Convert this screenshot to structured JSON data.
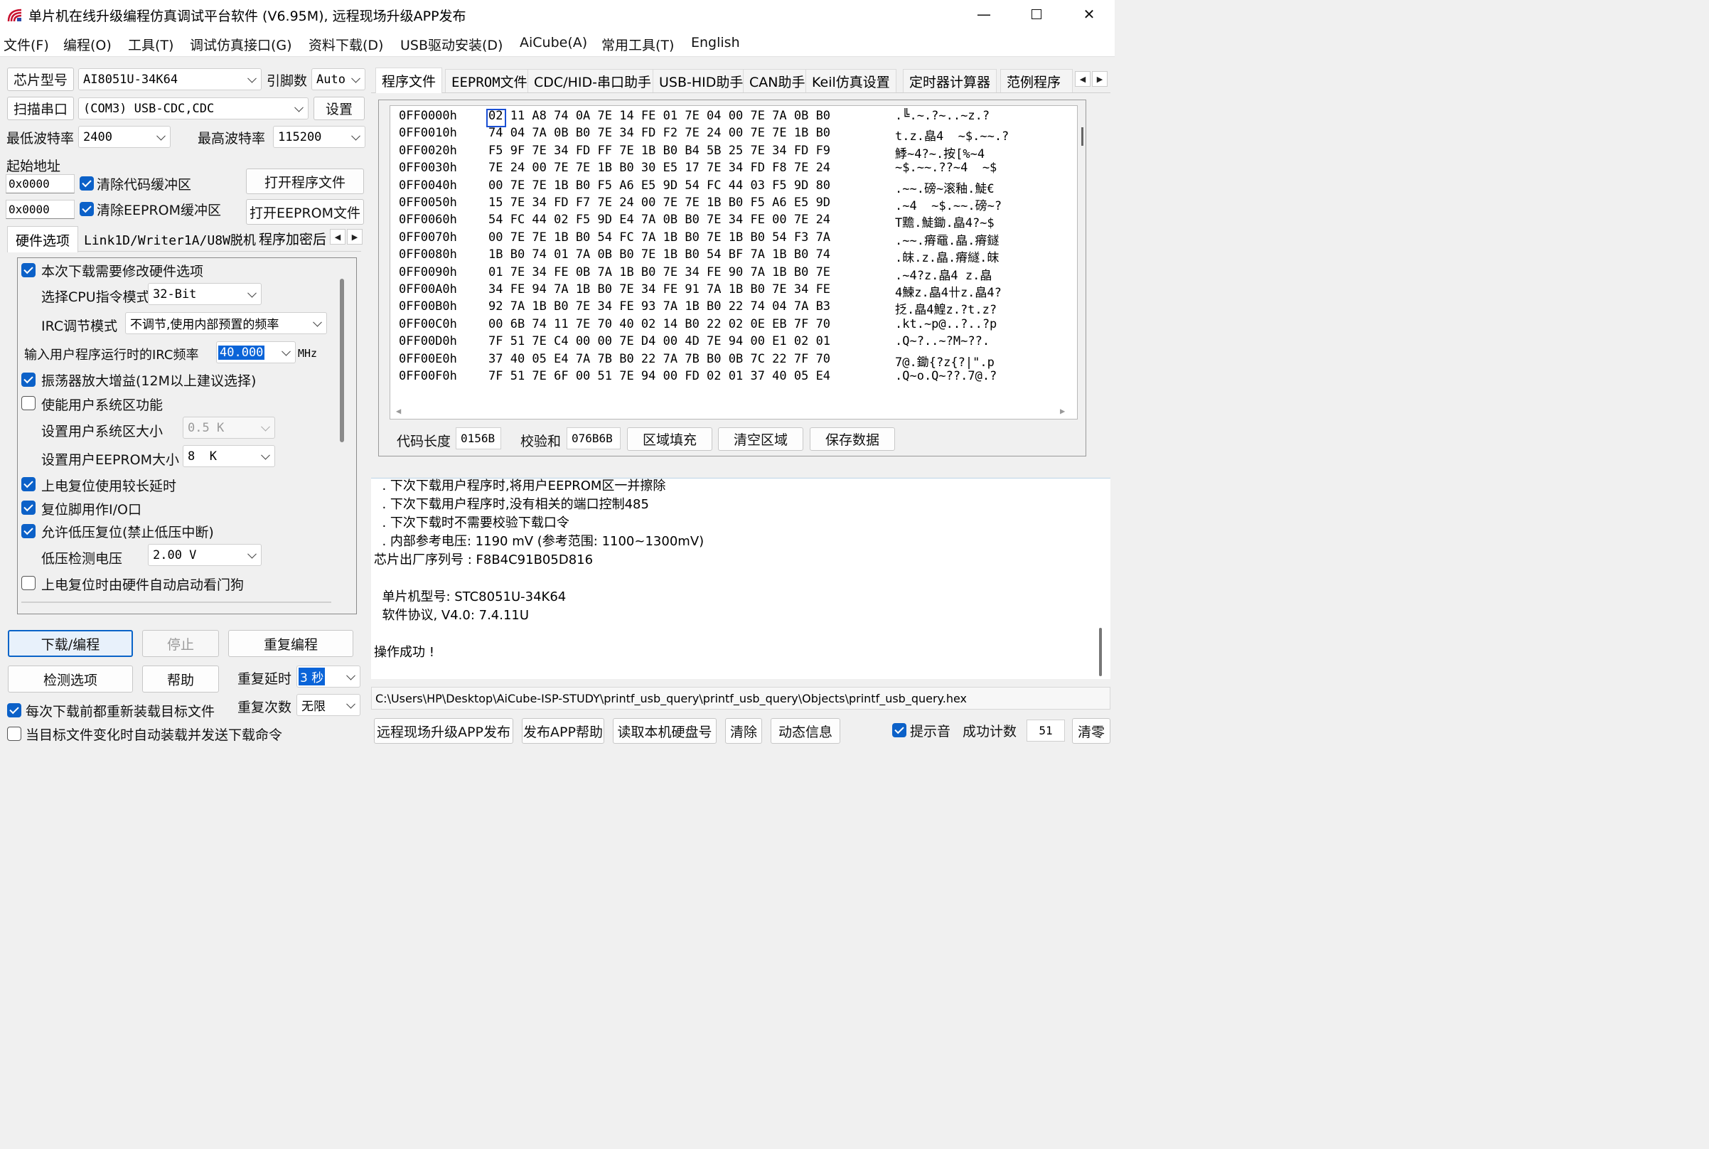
{
  "window": {
    "title": "单片机在线升级编程仿真调试平台软件 (V6.95M), 远程现场升级APP发布"
  },
  "menu": [
    "文件(F)",
    "编程(O)",
    "工具(T)",
    "调试仿真接口(G)",
    "资料下载(D)",
    "USB驱动安装(D)",
    "AiCube(A)",
    "常用工具(T)",
    "English"
  ],
  "chip": {
    "label": "芯片型号",
    "value": "AI8051U-34K64",
    "pins_label": "引脚数",
    "pins_value": "Auto"
  },
  "port": {
    "scan_label": "扫描串口",
    "value": "(COM3) USB-CDC,CDC",
    "settings_label": "设置"
  },
  "baud": {
    "min_label": "最低波特率",
    "min_value": "2400",
    "max_label": "最高波特率",
    "max_value": "115200"
  },
  "address": {
    "label": "起始地址",
    "code_addr": "0x0000",
    "eeprom_addr": "0x0000",
    "clear_code": "清除代码缓冲区",
    "clear_eeprom": "清除EEPROM缓冲区",
    "open_program": "打开程序文件",
    "open_eeprom": "打开EEPROM文件"
  },
  "left_tabs": [
    "硬件选项",
    "Link1D/Writer1A/U8W脱机",
    "程序加密后"
  ],
  "hw": {
    "modify": "本次下载需要修改硬件选项",
    "cpu_mode_label": "选择CPU指令模式",
    "cpu_mode_value": "32-Bit",
    "irc_mode_label": "IRC调节模式",
    "irc_mode_value": "不调节,使用内部预置的频率",
    "irc_freq_label": "输入用户程序运行时的IRC频率",
    "irc_freq_value": "40.000",
    "irc_freq_unit": "MHz",
    "osc_gain": "振荡器放大增益(12M以上建议选择)",
    "user_sys": "使能用户系统区功能",
    "user_sys_size_label": "设置用户系统区大小",
    "user_sys_size_value": "0.5 K",
    "user_eeprom_label": "设置用户EEPROM大小",
    "user_eeprom_value": "8  K",
    "long_delay": "上电复位使用较长延时",
    "reset_io": "复位脚用作I/O口",
    "low_volt_reset": "允许低压复位(禁止低压中断)",
    "low_volt_label": "低压检测电压",
    "low_volt_value": "2.00 V",
    "watchdog": "上电复位时由硬件自动启动看门狗"
  },
  "actions": {
    "download": "下载/编程",
    "stop": "停止",
    "reprogram": "重复编程",
    "check": "检测选项",
    "help": "帮助",
    "repeat_delay_label": "重复延时",
    "repeat_delay_value": "3 秒",
    "repeat_count_label": "重复次数",
    "repeat_count_value": "无限",
    "reload_each": "每次下载前都重新装载目标文件",
    "auto_reload": "当目标文件变化时自动装载并发送下载命令"
  },
  "right_tabs": [
    "程序文件",
    "EEPROM文件",
    "CDC/HID-串口助手",
    "USB-HID助手",
    "CAN助手",
    "Keil仿真设置",
    "定时器计算器",
    "范例程序"
  ],
  "hex_rows": [
    {
      "addr": "0FF0000h",
      "bytes": "02 11 A8 74 0A 7E 14 FE 01 7E 04 00 7E 7A 0B B0",
      "ascii": ".╚.~.?~..~z.?"
    },
    {
      "addr": "0FF0010h",
      "bytes": "74 04 7A 0B B0 7E 34 FD F2 7E 24 00 7E 7E 1B B0",
      "ascii": "t.z.皛4  ~$.~~.?"
    },
    {
      "addr": "0FF0020h",
      "bytes": "F5 9F 7E 34 FD FF 7E 1B B0 B4 5B 25 7E 34 FD F9",
      "ascii": "鯚~4?~.按[%~4"
    },
    {
      "addr": "0FF0030h",
      "bytes": "7E 24 00 7E 7E 1B B0 30 E5 17 7E 34 FD F8 7E 24",
      "ascii": "~$.~~.??~4  ~$"
    },
    {
      "addr": "0FF0040h",
      "bytes": "00 7E 7E 1B B0 F5 A6 E5 9D 54 FC 44 03 F5 9D 80",
      "ascii": ".~~.磅~滚釉.鯐€"
    },
    {
      "addr": "0FF0050h",
      "bytes": "15 7E 34 FD F7 7E 24 00 7E 7E 1B B0 F5 A6 E5 9D",
      "ascii": ".~4  ~$.~~.磅~?"
    },
    {
      "addr": "0FF0060h",
      "bytes": "54 FC 44 02 F5 9D E4 7A 0B B0 7E 34 FE 00 7E 24",
      "ascii": "T黵.鯐鋤.皛4?~$"
    },
    {
      "addr": "0FF0070h",
      "bytes": "00 7E 7E 1B B0 54 FC 7A 1B B0 7E 1B B0 54 F3 7A",
      "ascii": ".~~.瘠黿.皛.瘠鐩"
    },
    {
      "addr": "0FF0080h",
      "bytes": "1B B0 74 01 7A 0B B0 7E 1B B0 54 BF 7A 1B B0 74",
      "ascii": ".皌.z.皛.瘠繸.皌"
    },
    {
      "addr": "0FF0090h",
      "bytes": "01 7E 34 FE 0B 7A 1B B0 7E 34 FE 90 7A 1B B0 7E",
      "ascii": ".~4?z.皛4 z.皛"
    },
    {
      "addr": "0FF00A0h",
      "bytes": "34 FE 94 7A 1B B0 7E 34 FE 91 7A 1B B0 7E 34 FE",
      "ascii": "4鰊z.皛4卄z.皛4?"
    },
    {
      "addr": "0FF00B0h",
      "bytes": "92 7A 1B B0 7E 34 FE 93 7A 1B B0 22 74 04 7A B3",
      "ascii": "抸.皛4鰉z.?t.z?"
    },
    {
      "addr": "0FF00C0h",
      "bytes": "00 6B 74 11 7E 70 40 02 14 B0 22 02 0E EB 7F 70",
      "ascii": ".kt.~p@..?..?p"
    },
    {
      "addr": "0FF00D0h",
      "bytes": "7F 51 7E C4 00 00 7E D4 00 4D 7E 94 00 E1 02 01",
      "ascii": ".Q~?..~?M~??."
    },
    {
      "addr": "0FF00E0h",
      "bytes": "37 40 05 E4 7A 7B B0 22 7A 7B B0 0B 7C 22 7F 70",
      "ascii": "7@.鋤{?z{?|\".p"
    },
    {
      "addr": "0FF00F0h",
      "bytes": "7F 51 7E 6F 00 51 7E 94 00 FD 02 01 37 40 05 E4",
      "ascii": ".Q~o.Q~??.7@.?"
    }
  ],
  "hex_footer": {
    "code_len_label": "代码长度",
    "code_len_value": "0156B",
    "checksum_label": "校验和",
    "checksum_value": "076B6B",
    "fill": "区域填充",
    "clear": "清空区域",
    "save": "保存数据"
  },
  "log": [
    "  . 下次下载用户程序时,将用户EEPROM区一并擦除",
    "  . 下次下载用户程序时,没有相关的端口控制485",
    "  . 下次下载时不需要校验下载口令",
    "  . 内部参考电压: 1190 mV (参考范围: 1100~1300mV)",
    "芯片出厂序列号 : F8B4C91B05D816",
    "",
    "  单片机型号: STC8051U-34K64",
    "  软件协议, V4.0: 7.4.11U",
    "",
    "操作成功 !"
  ],
  "file_path": "C:\\Users\\HP\\Desktop\\AiCube-ISP-STUDY\\printf_usb_query\\printf_usb_query\\Objects\\printf_usb_query.hex",
  "bottom": {
    "remote": "远程现场升级APP发布",
    "publish_help": "发布APP帮助",
    "read_disk": "读取本机硬盘号",
    "clear": "清除",
    "dynamic": "动态信息",
    "beep": "提示音",
    "success_label": "成功计数",
    "success_value": "51",
    "reset": "清零"
  }
}
